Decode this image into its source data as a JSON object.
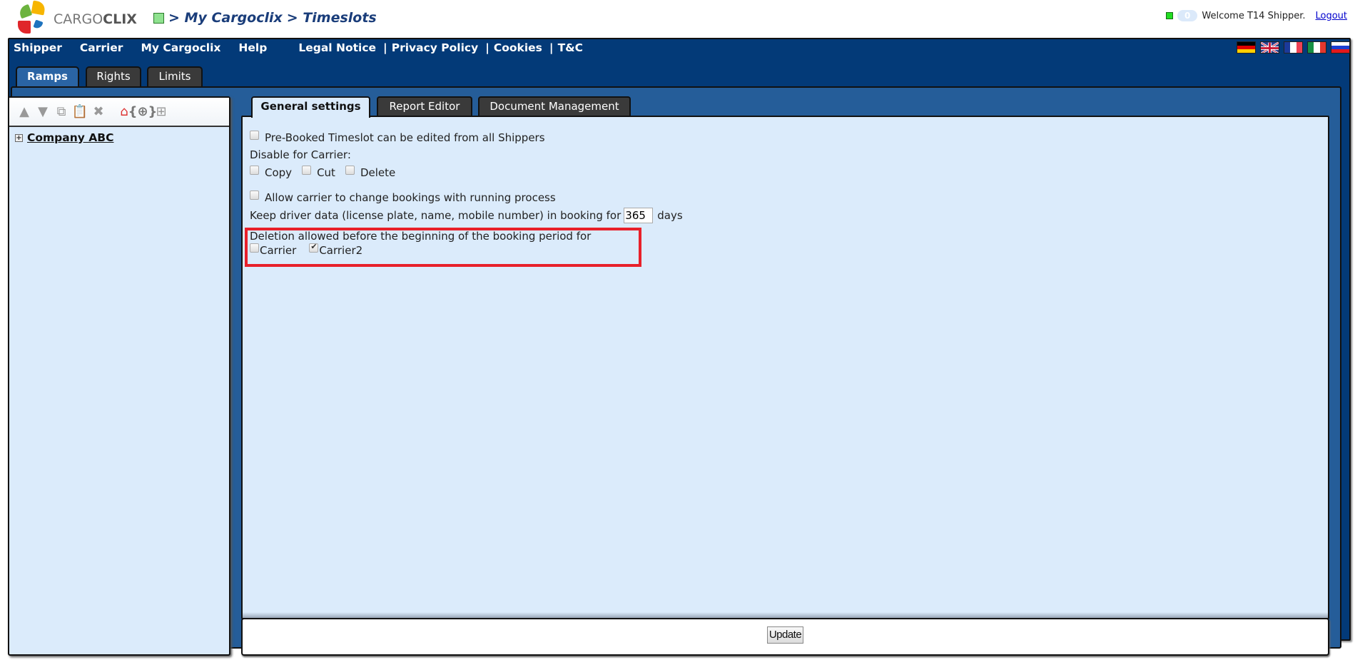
{
  "header": {
    "logo_text_light": "CARGO",
    "logo_text_bold": "CLIX",
    "breadcrumb": [
      "> My Cargoclix",
      "> Timeslots"
    ],
    "message_count": "0",
    "welcome": "Welcome T14 Shipper.",
    "logout": "Logout"
  },
  "menu": {
    "items": [
      "Shipper",
      "Carrier",
      "My Cargoclix",
      "Help"
    ],
    "legal": [
      "Legal Notice",
      "Privacy Policy",
      "Cookies",
      "T&C"
    ],
    "separator": "|"
  },
  "languages": [
    "German",
    "English",
    "French",
    "Italian",
    "Russian"
  ],
  "outer_tabs": [
    {
      "label": "Ramps",
      "active": true
    },
    {
      "label": "Rights",
      "active": false
    },
    {
      "label": "Limits",
      "active": false
    }
  ],
  "sidebar": {
    "toolbar": [
      "move-up",
      "move-down",
      "copy",
      "paste",
      "delete",
      "add-location",
      "add-ramp-group",
      "add-ramp"
    ],
    "tree": [
      {
        "label": "Company ABC",
        "expander": "+"
      }
    ]
  },
  "inner_tabs": [
    {
      "label": "General settings",
      "active": true
    },
    {
      "label": "Report Editor",
      "active": false
    },
    {
      "label": "Document Management",
      "active": false
    }
  ],
  "settings": {
    "prebooked_label": "Pre-Booked Timeslot can be edited from all Shippers",
    "prebooked_checked": false,
    "disable_for_carrier_label": "Disable for Carrier:",
    "disable_options": [
      {
        "label": "Copy",
        "checked": false
      },
      {
        "label": "Cut",
        "checked": false
      },
      {
        "label": "Delete",
        "checked": false
      }
    ],
    "allow_change_label": "Allow carrier to change bookings with running process",
    "allow_change_checked": false,
    "keep_driver_label": "Keep driver data (license plate, name, mobile number) in booking for",
    "keep_driver_days": "365",
    "days_label": "days",
    "deletion_label": "Deletion allowed before the beginning of the booking period for",
    "deletion_options": [
      {
        "label": "Carrier",
        "checked": false
      },
      {
        "label": "Carrier2",
        "checked": true
      }
    ]
  },
  "footer": {
    "update_label": "Update"
  },
  "colors": {
    "navy": "#033a78",
    "panel_blue": "#255d99",
    "content_bg": "#dbebfb",
    "highlight_red": "#e8202a"
  }
}
